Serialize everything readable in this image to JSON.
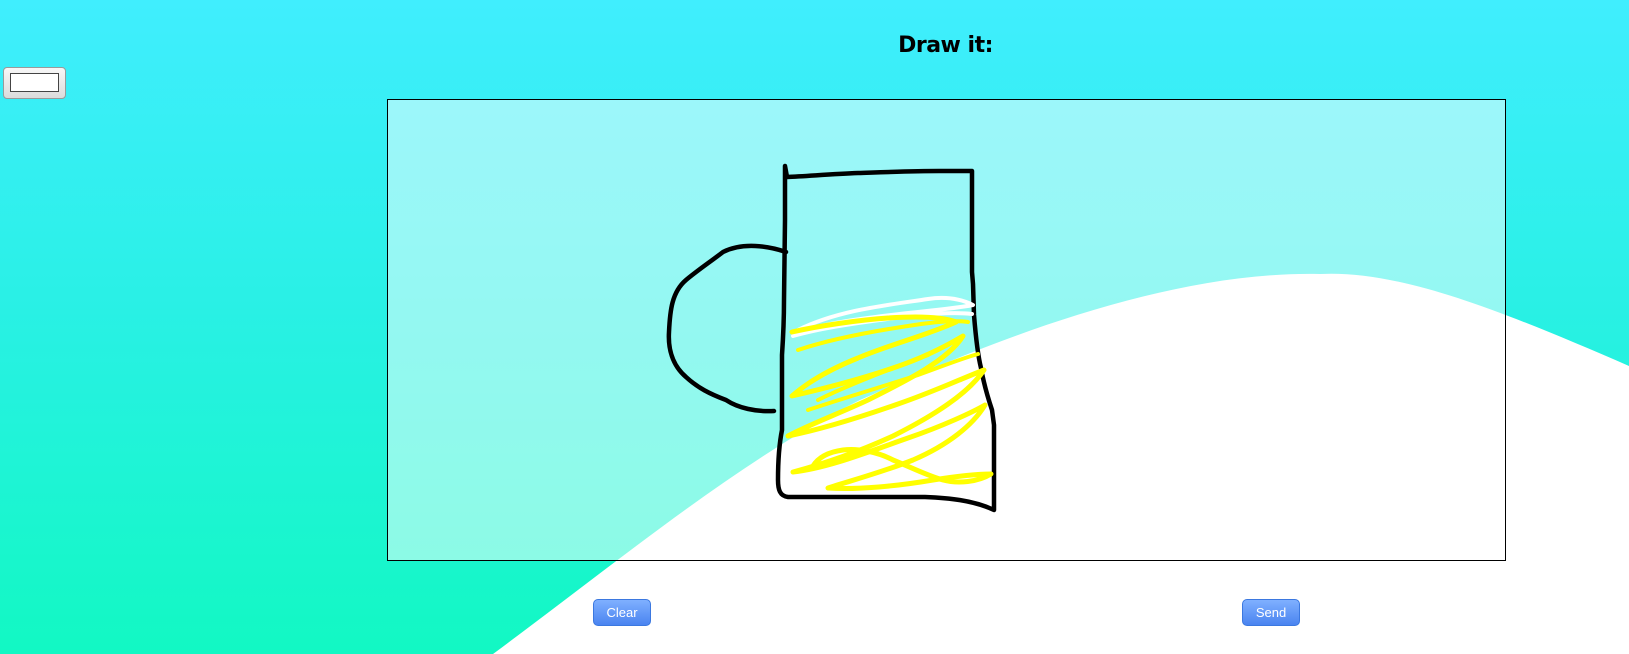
{
  "header": {
    "title": "Draw it:"
  },
  "toolbar": {
    "color_value": "#ffffff"
  },
  "canvas": {
    "background_color": "rgba(255,255,255,0.5)",
    "strokes": [
      {
        "name": "jug-body-stroke",
        "color": "#000000"
      },
      {
        "name": "jug-handle-stroke",
        "color": "#000000"
      },
      {
        "name": "liquid-top-stroke",
        "color": "#ffffff"
      },
      {
        "name": "liquid-fill-stroke",
        "color": "#ffff00"
      }
    ]
  },
  "actions": {
    "clear_label": "Clear",
    "send_label": "Send"
  },
  "colors": {
    "accent": "#4a84f0",
    "background_top": "#40eefe",
    "background_bottom": "#12f8c3",
    "wave": "#ffffff"
  }
}
